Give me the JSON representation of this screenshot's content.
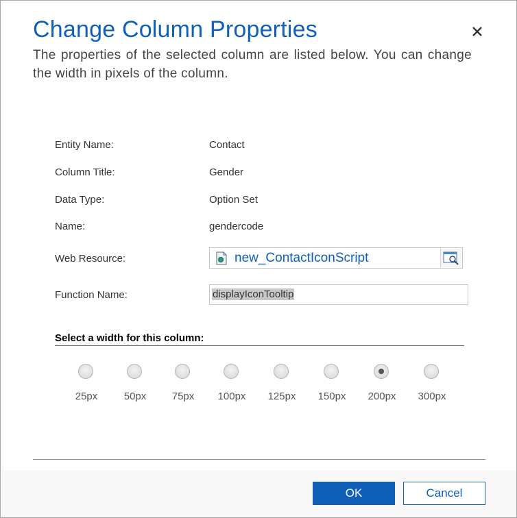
{
  "dialog": {
    "title": "Change Column Properties",
    "description": "The properties of the selected column are listed below. You can change the width in pixels of the column."
  },
  "properties": {
    "entity_name": {
      "label": "Entity Name:",
      "value": "Contact"
    },
    "column_title": {
      "label": "Column Title:",
      "value": "Gender"
    },
    "data_type": {
      "label": "Data Type:",
      "value": "Option Set"
    },
    "name": {
      "label": "Name:",
      "value": "gendercode"
    },
    "web_resource": {
      "label": "Web Resource:",
      "value": "new_ContactIconScript"
    },
    "function_name": {
      "label": "Function Name:",
      "value": "displayIconTooltip"
    }
  },
  "width_selector": {
    "heading": "Select a width for this column:",
    "selected": "200px",
    "options": [
      "25px",
      "50px",
      "75px",
      "100px",
      "125px",
      "150px",
      "200px",
      "300px"
    ]
  },
  "buttons": {
    "ok": "OK",
    "cancel": "Cancel"
  },
  "colors": {
    "accent": "#1160b7",
    "text": "#333333",
    "footer_bg": "#f8f8f8"
  },
  "icons": {
    "close": "close-icon",
    "web_resource_doc": "script-document-icon",
    "lookup": "lookup-search-icon"
  }
}
